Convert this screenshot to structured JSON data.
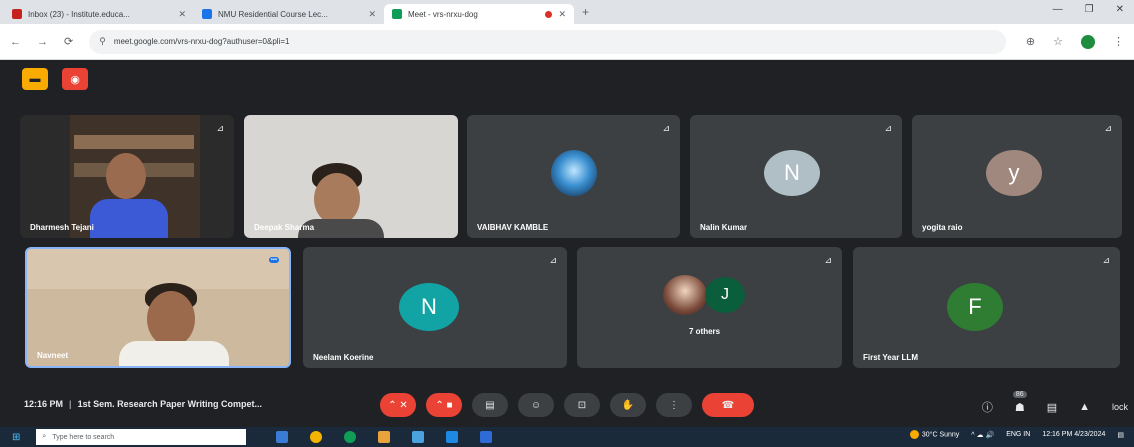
{
  "browser": {
    "tabs": [
      {
        "label": "Inbox (23) - Institute.educa...",
        "icon_color": "#c5221f",
        "active": false,
        "close": "✕"
      },
      {
        "label": "NMU Residential Course Lec...",
        "icon_color": "#1a73e8",
        "active": false,
        "close": "✕"
      },
      {
        "label": "Meet - vrs-nrxu-dog",
        "icon_color": "#0f9d58",
        "active": true,
        "close": "✕"
      }
    ],
    "new_tab": "+",
    "window_controls": [
      "—",
      "❐",
      "✕"
    ],
    "url": "meet.google.com/vrs-nrxu-dog?authuser=0&pli=1",
    "nav": [
      "←",
      "→",
      "⟳"
    ],
    "omnibox_icons": [
      "⊕",
      "☆",
      "⋮"
    ]
  },
  "meet": {
    "badges": [
      {
        "icon": "folder-icon",
        "glyph": "▪"
      },
      {
        "icon": "record-icon",
        "glyph": "◉"
      }
    ],
    "tiles_row1": [
      {
        "name": "Dharmesh Tejani",
        "type": "video",
        "pin": "⊿"
      },
      {
        "name": "Deepak Sharma",
        "type": "video",
        "pin": ""
      },
      {
        "name": "VAIBHAV KAMBLE",
        "type": "image",
        "pin": "⊿"
      },
      {
        "name": "Nalin Kumar",
        "type": "avatar",
        "letter": "N",
        "color": "#b0bec5",
        "pin": "⊿"
      },
      {
        "name": "yogita raio",
        "type": "avatar",
        "letter": "y",
        "color": "#a1887f",
        "pin": "⊿"
      }
    ],
    "tiles_row2": [
      {
        "name": "Navneet",
        "type": "video",
        "pin": "▪▪▪"
      },
      {
        "name": "Neelam Koerine",
        "type": "avatar",
        "letter": "N",
        "color": "#12a4a4",
        "pin": "⊿"
      },
      {
        "name": "7 others",
        "type": "group",
        "letter": "J",
        "color": "#0b5e3b",
        "pin": "⊿"
      },
      {
        "name": "First Year LLM",
        "type": "avatar",
        "letter": "F",
        "color": "#2e7d32",
        "pin": "⊿"
      }
    ]
  },
  "controls": {
    "time": "12:16 PM",
    "separator": "|",
    "meeting_title": "1st Sem. Research Paper Writing Compet...",
    "buttons": [
      {
        "name": "mic",
        "glyph": "⌃ ✕",
        "red": true
      },
      {
        "name": "camera",
        "glyph": "⌃ ■",
        "red": true
      },
      {
        "name": "captions",
        "glyph": "▤",
        "red": false
      },
      {
        "name": "emoji",
        "glyph": "☺",
        "red": false
      },
      {
        "name": "present",
        "glyph": "⊡",
        "red": false
      },
      {
        "name": "raise-hand",
        "glyph": "✋",
        "red": false
      },
      {
        "name": "more",
        "glyph": "⋮",
        "red": false
      },
      {
        "name": "end-call",
        "glyph": "☎",
        "red": true
      }
    ],
    "right": {
      "info": "ⓘ",
      "people": "👥",
      "people_count": "86",
      "chat": "▤",
      "activities": "▲",
      "lock": "lock"
    }
  },
  "taskbar": {
    "start": "⊞",
    "search_placeholder": "Type here to search",
    "apps": [
      "#3a7bd5",
      "#f4b400",
      "#0f9d58",
      "#e8a33c",
      "#4aa3df",
      "#1e88e5",
      "#2f6bd6"
    ],
    "weather": "30°C Sunny",
    "tray": "^ ☁ 🔊",
    "lang": "ENG IN",
    "clock": "12:16 PM 4/23/2024"
  }
}
